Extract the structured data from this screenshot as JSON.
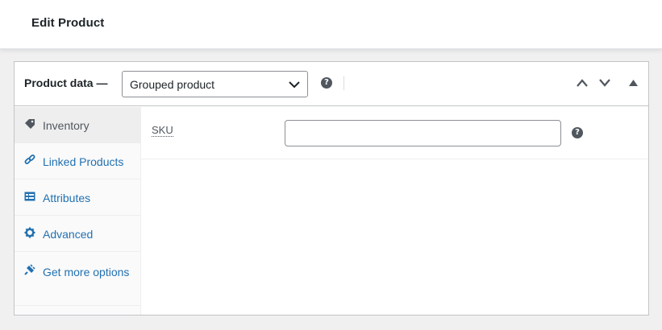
{
  "page": {
    "title": "Edit Product"
  },
  "product_data": {
    "label": "Product data —",
    "type_select": {
      "selected": "Grouped product"
    },
    "help_icon": "question-circle-icon",
    "controls": [
      "move-up-icon",
      "move-down-icon",
      "toggle-collapse-icon"
    ]
  },
  "tabs": [
    {
      "label": "Inventory",
      "icon": "tag-icon",
      "active": true
    },
    {
      "label": "Linked Products",
      "icon": "link-icon",
      "active": false
    },
    {
      "label": "Attributes",
      "icon": "list-table-icon",
      "active": false
    },
    {
      "label": "Advanced",
      "icon": "gear-icon",
      "active": false
    },
    {
      "label": "Get more options",
      "icon": "plugin-icon",
      "active": false
    }
  ],
  "inventory": {
    "sku_label": "SKU",
    "sku_value": ""
  },
  "colors": {
    "link": "#2271b1",
    "active_tab_bg": "#eeeeee",
    "border": "#c3c4c7",
    "background": "#f0f0f1"
  }
}
